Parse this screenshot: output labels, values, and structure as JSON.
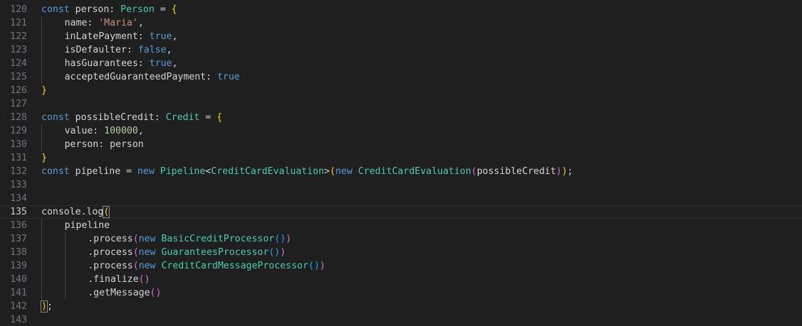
{
  "editor": {
    "lines": [
      {
        "num": "120",
        "indent": 0,
        "tokens": [
          [
            "kw",
            "const"
          ],
          [
            "plain",
            " person: "
          ],
          [
            "type",
            "Person"
          ],
          [
            "plain",
            " = "
          ],
          [
            "b1",
            "{"
          ]
        ]
      },
      {
        "num": "121",
        "indent": 1,
        "tokens": [
          [
            "plain",
            "name: "
          ],
          [
            "str",
            "'Maria'"
          ],
          [
            "plain",
            ","
          ]
        ]
      },
      {
        "num": "122",
        "indent": 1,
        "tokens": [
          [
            "plain",
            "inLatePayment: "
          ],
          [
            "kw",
            "true"
          ],
          [
            "plain",
            ","
          ]
        ]
      },
      {
        "num": "123",
        "indent": 1,
        "tokens": [
          [
            "plain",
            "isDefaulter: "
          ],
          [
            "kw",
            "false"
          ],
          [
            "plain",
            ","
          ]
        ]
      },
      {
        "num": "124",
        "indent": 1,
        "tokens": [
          [
            "plain",
            "hasGuarantees: "
          ],
          [
            "kw",
            "true"
          ],
          [
            "plain",
            ","
          ]
        ]
      },
      {
        "num": "125",
        "indent": 1,
        "tokens": [
          [
            "plain",
            "acceptedGuaranteedPayment: "
          ],
          [
            "kw",
            "true"
          ]
        ]
      },
      {
        "num": "126",
        "indent": 0,
        "tokens": [
          [
            "b1",
            "}"
          ]
        ]
      },
      {
        "num": "127",
        "indent": 0,
        "tokens": []
      },
      {
        "num": "128",
        "indent": 0,
        "tokens": [
          [
            "kw",
            "const"
          ],
          [
            "plain",
            " possibleCredit: "
          ],
          [
            "type",
            "Credit"
          ],
          [
            "plain",
            " = "
          ],
          [
            "b1",
            "{"
          ]
        ]
      },
      {
        "num": "129",
        "indent": 1,
        "tokens": [
          [
            "plain",
            "value: "
          ],
          [
            "num",
            "100000"
          ],
          [
            "plain",
            ","
          ]
        ]
      },
      {
        "num": "130",
        "indent": 1,
        "tokens": [
          [
            "plain",
            "person: person"
          ]
        ]
      },
      {
        "num": "131",
        "indent": 0,
        "tokens": [
          [
            "b1",
            "}"
          ]
        ]
      },
      {
        "num": "132",
        "indent": 0,
        "tokens": [
          [
            "kw",
            "const"
          ],
          [
            "plain",
            " pipeline = "
          ],
          [
            "kw",
            "new"
          ],
          [
            "plain",
            " "
          ],
          [
            "type",
            "Pipeline"
          ],
          [
            "plain",
            "<"
          ],
          [
            "type",
            "CreditCardEvaluation"
          ],
          [
            "plain",
            ">"
          ],
          [
            "b1",
            "("
          ],
          [
            "kw",
            "new"
          ],
          [
            "plain",
            " "
          ],
          [
            "type",
            "CreditCardEvaluation"
          ],
          [
            "b2",
            "("
          ],
          [
            "plain",
            "possibleCredit"
          ],
          [
            "b2",
            ")"
          ],
          [
            "b1",
            ")"
          ],
          [
            "plain",
            ";"
          ]
        ]
      },
      {
        "num": "133",
        "indent": 0,
        "tokens": []
      },
      {
        "num": "134",
        "indent": 0,
        "tokens": []
      },
      {
        "num": "135",
        "indent": 0,
        "current": true,
        "tokens": [
          [
            "plain",
            "console.log"
          ],
          [
            "b1m",
            "("
          ]
        ]
      },
      {
        "num": "136",
        "indent": 1,
        "tokens": [
          [
            "plain",
            "pipeline"
          ]
        ]
      },
      {
        "num": "137",
        "indent": 2,
        "tokens": [
          [
            "plain",
            ".process"
          ],
          [
            "b2",
            "("
          ],
          [
            "kw",
            "new"
          ],
          [
            "plain",
            " "
          ],
          [
            "type",
            "BasicCreditProcessor"
          ],
          [
            "b3",
            "("
          ],
          [
            "b3",
            ")"
          ],
          [
            "b2",
            ")"
          ]
        ]
      },
      {
        "num": "138",
        "indent": 2,
        "tokens": [
          [
            "plain",
            ".process"
          ],
          [
            "b2",
            "("
          ],
          [
            "kw",
            "new"
          ],
          [
            "plain",
            " "
          ],
          [
            "type",
            "GuaranteesProcessor"
          ],
          [
            "b3",
            "("
          ],
          [
            "b3",
            ")"
          ],
          [
            "b2",
            ")"
          ]
        ]
      },
      {
        "num": "139",
        "indent": 2,
        "tokens": [
          [
            "plain",
            ".process"
          ],
          [
            "b2",
            "("
          ],
          [
            "kw",
            "new"
          ],
          [
            "plain",
            " "
          ],
          [
            "type",
            "CreditCardMessageProcessor"
          ],
          [
            "b3",
            "("
          ],
          [
            "b3",
            ")"
          ],
          [
            "b2",
            ")"
          ]
        ]
      },
      {
        "num": "140",
        "indent": 2,
        "tokens": [
          [
            "plain",
            ".finalize"
          ],
          [
            "b2",
            "("
          ],
          [
            "b2",
            ")"
          ]
        ]
      },
      {
        "num": "141",
        "indent": 2,
        "tokens": [
          [
            "plain",
            ".getMessage"
          ],
          [
            "b2",
            "("
          ],
          [
            "b2",
            ")"
          ]
        ]
      },
      {
        "num": "142",
        "indent": 0,
        "tokens": [
          [
            "b1m",
            ")"
          ],
          [
            "plain",
            ";"
          ]
        ]
      },
      {
        "num": "143",
        "indent": 0,
        "tokens": []
      }
    ]
  },
  "colors": {
    "background": "#1f1f1f",
    "keyword": "#569cd6",
    "type": "#4ec9b0",
    "string": "#ce9178",
    "number": "#b5cea8",
    "bracket_level1": "#ffd700",
    "bracket_level2": "#da70d6",
    "bracket_level3": "#179fff"
  }
}
